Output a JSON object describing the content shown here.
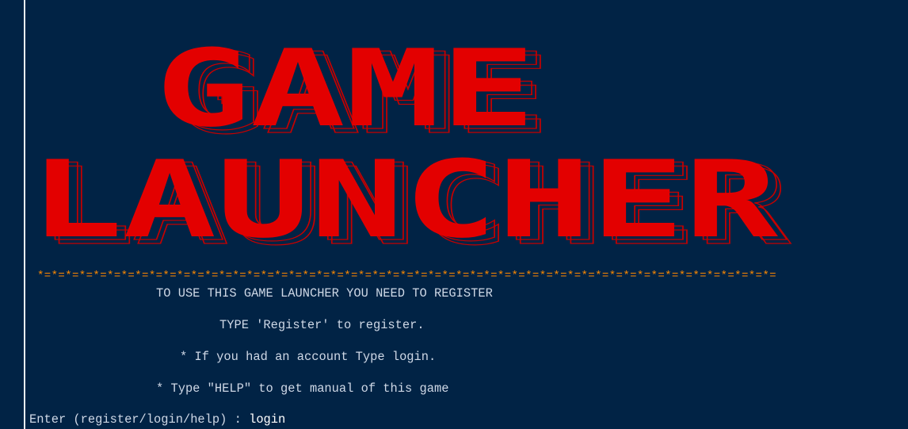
{
  "banner": {
    "line1": "GAME",
    "line2": "LAUNCHER",
    "color": "#e30000",
    "shadow_color": "#c50000"
  },
  "divider": {
    "text": "*=*=*=*=*=*=*=*=*=*=*=*=*=*=*=*=*=*=*=*=*=*=*=*=*=*=*=*=*=*=*=*=*=*=*=*=*=*=*=*=*=*=*=*=*=*=*=*=*=*=*=*=*=",
    "color": "#ff8a00"
  },
  "messages": {
    "register_notice": "TO USE THIS GAME LAUNCHER YOU NEED TO REGISTER",
    "register_hint": "TYPE 'Register' to register.",
    "login_hint": "* If you had an account Type login.",
    "help_hint": "* Type \"HELP\" to get manual of this game"
  },
  "prompt": {
    "label": "Enter (register/login/help) : ",
    "input_value": "login"
  },
  "colors": {
    "background": "#012345",
    "text": "#cfd8e6"
  }
}
